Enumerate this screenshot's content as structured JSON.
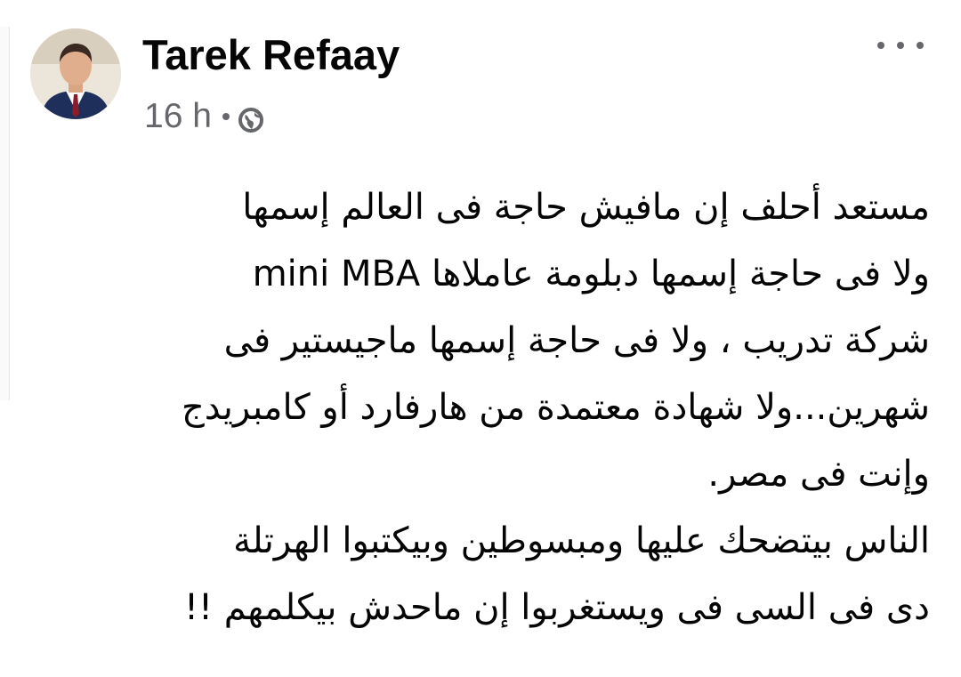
{
  "post": {
    "author": "Tarek Refaay",
    "timestamp": "16 h",
    "audience_icon": "globe-icon",
    "more_icon": "more-options-icon",
    "lines": [
      "مستعد أحلف إن مافيش حاجة فى العالم إسمها",
      "ولا فى حاجة إسمها دبلومة عاملاها mini MBA",
      "شركة تدريب ، ولا فى حاجة إسمها ماجيستير فى",
      "شهرين...ولا شهادة معتمدة من هارفارد أو كامبريدج",
      "وإنت فى مصر.",
      "الناس بيتضحك عليها ومبسوطين وبيكتبوا الهرتلة",
      "دى فى السى فى ويستغربوا إن ماحدش بيكلمهم !!"
    ]
  },
  "colors": {
    "text": "#050505",
    "secondary": "#65676b",
    "background": "#ffffff"
  }
}
